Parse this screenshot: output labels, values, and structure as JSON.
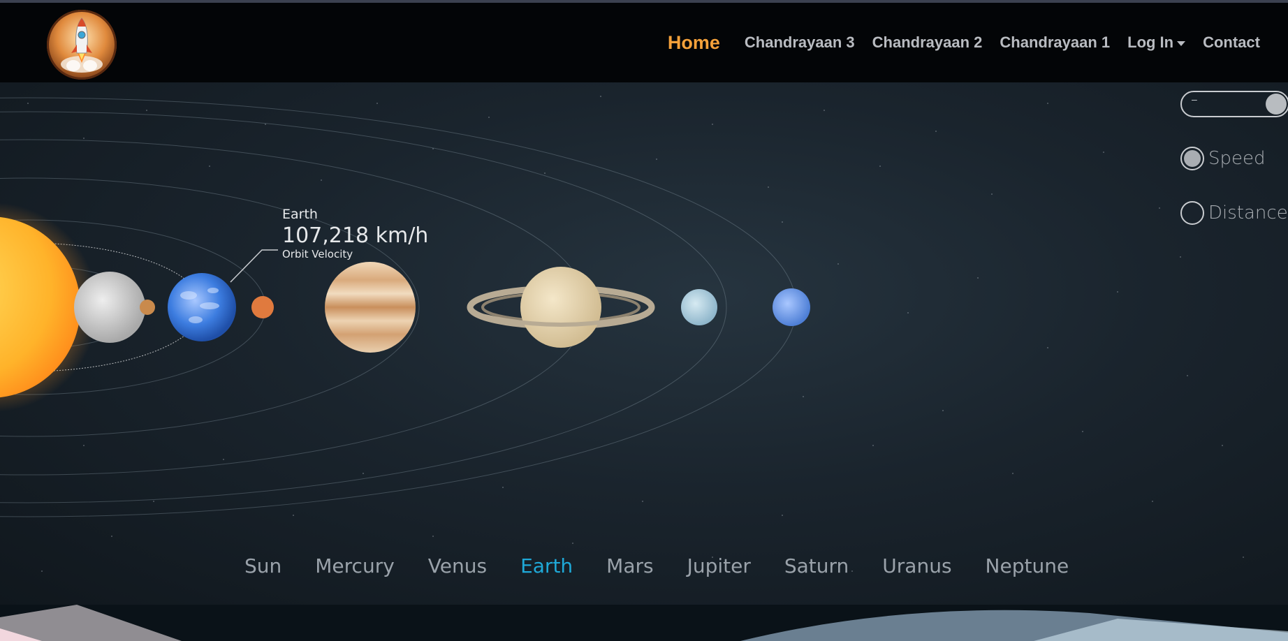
{
  "nav": {
    "logo_icon": "rocket-logo-icon",
    "links": [
      {
        "label": "Home",
        "active": true
      },
      {
        "label": "Chandrayaan 3",
        "active": false
      },
      {
        "label": "Chandrayaan 2",
        "active": false
      },
      {
        "label": "Chandrayaan 1",
        "active": false
      },
      {
        "label": "Log In",
        "active": false,
        "dropdown": true
      },
      {
        "label": "Contact",
        "active": false
      }
    ]
  },
  "controls": {
    "toggle_symbol": "–",
    "speed_label": "Speed",
    "distance_label": "Distance",
    "selected": "Speed"
  },
  "readout": {
    "planet": "Earth",
    "value": "107,218 km/h",
    "label": "Orbit Velocity"
  },
  "planets": [
    "Sun",
    "Mercury",
    "Venus",
    "Earth",
    "Mars",
    "Jupiter",
    "Saturn",
    "Uranus",
    "Neptune"
  ],
  "selected_planet": "Earth",
  "colors": {
    "accent_nav": "#f5a13a",
    "accent_tab": "#1fa9d8",
    "background": "#1a242d"
  }
}
